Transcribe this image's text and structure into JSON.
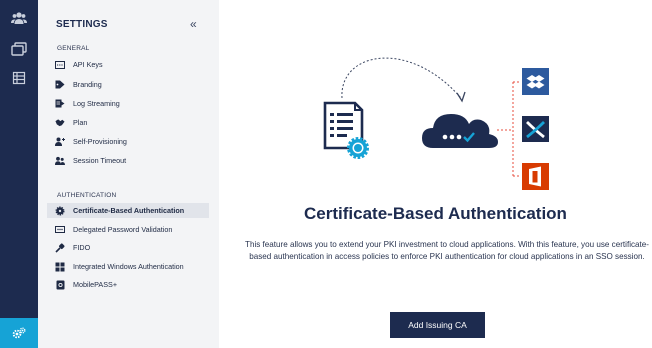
{
  "rail": {
    "icons": [
      "team-icon",
      "windows-icon",
      "list-icon"
    ],
    "bottom_icon": "settings-gears-icon",
    "accent": "#16a3d6"
  },
  "settings": {
    "title": "SETTINGS",
    "collapse_label": "«",
    "general_label": "GENERAL",
    "general_items": [
      {
        "label": "API Keys",
        "icon": "api-key-icon"
      },
      {
        "label": "Branding",
        "icon": "tag-icon"
      },
      {
        "label": "Log Streaming",
        "icon": "log-stream-icon"
      },
      {
        "label": "Plan",
        "icon": "handshake-icon"
      },
      {
        "label": "Self-Provisioning",
        "icon": "user-add-icon"
      },
      {
        "label": "Session Timeout",
        "icon": "users-icon"
      }
    ],
    "auth_label": "AUTHENTICATION",
    "auth_items": [
      {
        "label": "Certificate-Based Authentication",
        "icon": "badge-gear-icon",
        "active": true
      },
      {
        "label": "Delegated Password Validation",
        "icon": "password-icon"
      },
      {
        "label": "FIDO",
        "icon": "key-icon"
      },
      {
        "label": "Integrated Windows Authentication",
        "icon": "windows-logo-icon"
      },
      {
        "label": "MobilePASS+",
        "icon": "mobilepass-icon"
      }
    ]
  },
  "main": {
    "title": "Certificate-Based Authentication",
    "description": "This feature allows you to extend your PKI investment to cloud applications. With this feature, you use certificate-based authentication in access policies to enforce PKI authentication for cloud applications in an SSO session.",
    "button_label": "Add Issuing CA",
    "app_icons": [
      "dropbox-icon",
      "confluence-icon",
      "office-icon"
    ]
  },
  "colors": {
    "navy": "#1d2b4f",
    "cyan": "#16a3d6",
    "office_red": "#d83b01",
    "app_blue": "#2d5a9e"
  }
}
